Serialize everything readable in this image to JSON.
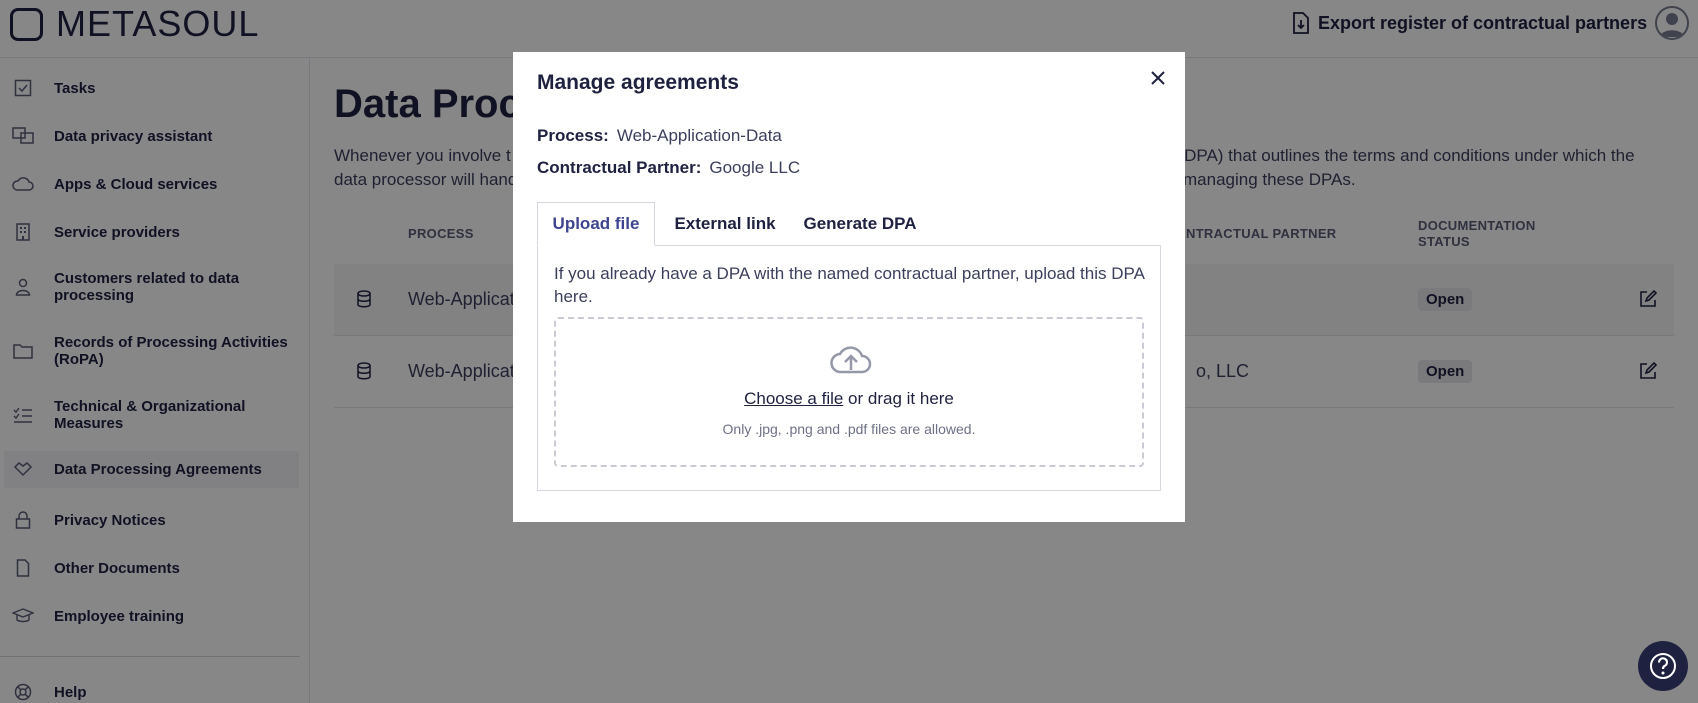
{
  "header": {
    "logo_text": "METASOUL",
    "export_label": "Export register of contractual partners"
  },
  "sidebar": {
    "items": [
      {
        "label": "Tasks",
        "icon": "checkbox-icon"
      },
      {
        "label": "Data privacy assistant",
        "icon": "assistant-icon"
      },
      {
        "label": "Apps & Cloud services",
        "icon": "cloud-icon"
      },
      {
        "label": "Service providers",
        "icon": "building-icon"
      },
      {
        "label": "Customers related to data processing",
        "icon": "person-icon"
      },
      {
        "label": "Records of Processing Activities (RoPA)",
        "icon": "folder-icon"
      },
      {
        "label": "Technical & Organizational Measures",
        "icon": "checklist-icon"
      },
      {
        "label": "Data Processing Agreements",
        "icon": "agreement-icon"
      },
      {
        "label": "Privacy Notices",
        "icon": "lock-icon"
      },
      {
        "label": "Other Documents",
        "icon": "document-icon"
      },
      {
        "label": "Employee training",
        "icon": "graduation-cap-icon"
      },
      {
        "label": "Help",
        "icon": "lifebuoy-icon"
      }
    ]
  },
  "main": {
    "title": "Data Proc",
    "description_line1": "Whenever you involve t",
    "description_line1_end": "t (DPA) that outlines the terms and conditions under which the",
    "description_line2": "data processor will hand",
    "description_line2_end": "managing these DPAs.",
    "columns": {
      "process": "PROCESS",
      "partner": "NTRACTUAL PARTNER",
      "status": "DOCUMENTATION STATUS"
    },
    "rows": [
      {
        "process": "Web-Applicat",
        "partner": "",
        "status": "Open"
      },
      {
        "process": "Web-Applicat",
        "partner": "o, LLC",
        "status": "Open"
      }
    ]
  },
  "modal": {
    "title": "Manage agreements",
    "process_label": "Process:",
    "process_value": "Web-Application-Data",
    "partner_label": "Contractual Partner:",
    "partner_value": "Google LLC",
    "tabs": [
      {
        "label": "Upload file",
        "active": true
      },
      {
        "label": "External link",
        "active": false
      },
      {
        "label": "Generate DPA",
        "active": false
      }
    ],
    "upload_text": "If you already have a DPA with the named contractual partner, upload this DPA here.",
    "choose_link": "Choose a file",
    "drag_text": " or drag it here",
    "allowed_note": "Only .jpg, .png and .pdf files are allowed."
  },
  "colors": {
    "brand": "#1f2140",
    "accent": "#3d4591",
    "overlay": "rgba(0,0,0,0.47)"
  }
}
